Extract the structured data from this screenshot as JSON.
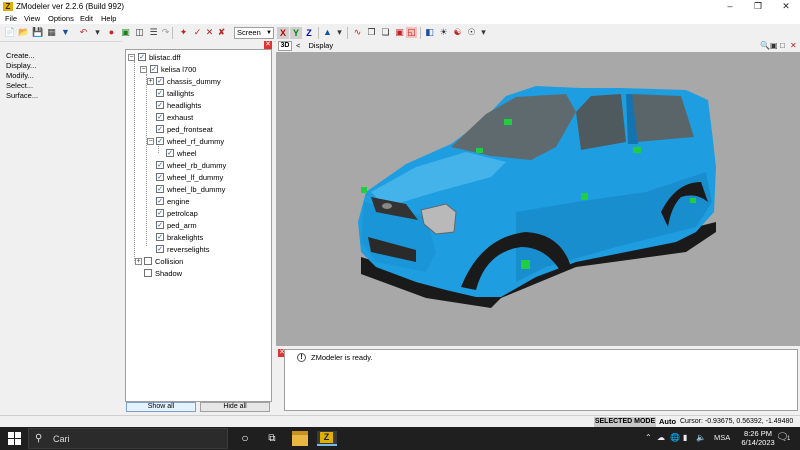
{
  "window": {
    "title": "ZModeler ver 2.2.6 (Build 992)",
    "app_icon": "Z",
    "controls": [
      "minimize-icon",
      "maximize-icon",
      "close-icon"
    ]
  },
  "menu": [
    {
      "label": "File"
    },
    {
      "label": "View"
    },
    {
      "label": "Options"
    },
    {
      "label": "Edit"
    },
    {
      "label": "Help"
    }
  ],
  "toolbar": {
    "view_mode": "Screen",
    "axes": [
      "X",
      "Y",
      "Z"
    ],
    "axis_colors": {
      "X": "#c00000",
      "Y": "#008000",
      "Z": "#0000c0"
    }
  },
  "commands": [
    "Create...",
    "Display...",
    "Modify...",
    "Select...",
    "Surface..."
  ],
  "tree": {
    "root": "blistac.dff",
    "nodes": [
      {
        "label": "kelisa l700",
        "checked": true,
        "expander": "−"
      },
      {
        "label": "chassis_dummy",
        "checked": true,
        "expander": "+"
      },
      {
        "label": "taillights",
        "checked": true
      },
      {
        "label": "headlights",
        "checked": true
      },
      {
        "label": "exhaust",
        "checked": true
      },
      {
        "label": "ped_frontseat",
        "checked": true
      },
      {
        "label": "wheel_rf_dummy",
        "checked": true,
        "expander": "−"
      },
      {
        "label": "wheel",
        "checked": true
      },
      {
        "label": "wheel_rb_dummy",
        "checked": true
      },
      {
        "label": "wheel_lf_dummy",
        "checked": true
      },
      {
        "label": "wheel_lb_dummy",
        "checked": true
      },
      {
        "label": "engine",
        "checked": true
      },
      {
        "label": "petrolcap",
        "checked": true
      },
      {
        "label": "ped_arm",
        "checked": true
      },
      {
        "label": "brakelights",
        "checked": true
      },
      {
        "label": "reverselights",
        "checked": true
      },
      {
        "label": "Collision",
        "checked": false,
        "expander": "+"
      },
      {
        "label": "Shadow",
        "checked": false
      }
    ],
    "show_all": "Show all",
    "hide_all": "Hide all"
  },
  "viewport": {
    "view_tag": "3D",
    "display_label": "Display",
    "background": "#a8a8a8",
    "car_color": "#1e9ee0",
    "dummy_color": "#1fcf3f"
  },
  "log": {
    "message": "ZModeler is ready."
  },
  "status": {
    "mode": "SELECTED MODE",
    "snap": "Auto",
    "cursor": "Cursor: -0.93675, 0.56392, -1.49480"
  },
  "taskbar": {
    "search_placeholder": "Cari",
    "language": "MSA",
    "time": "8:26 PM",
    "date": "6/14/2023",
    "notification_count": "1"
  }
}
